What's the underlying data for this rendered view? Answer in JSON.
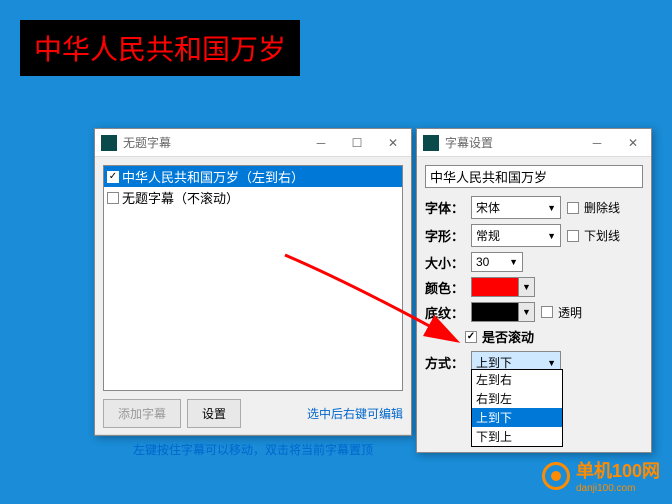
{
  "banner": "中华人民共和国万岁",
  "window1": {
    "title": "无题字幕",
    "list": [
      {
        "checked": true,
        "text": "中华人民共和国万岁（左到右）",
        "selected": true
      },
      {
        "checked": false,
        "text": "无题字幕（不滚动）",
        "selected": false
      }
    ],
    "btn_add": "添加字幕",
    "btn_settings": "设置",
    "hint_right": "选中后右键可编辑",
    "footer": "左键按住字幕可以移动，双击将当前字幕置顶"
  },
  "window2": {
    "title": "字幕设置",
    "input_value": "中华人民共和国万岁",
    "fields": {
      "font_label": "字体：",
      "font_value": "宋体",
      "strike_label": "删除线",
      "style_label": "字形：",
      "style_value": "常规",
      "underline_label": "下划线",
      "size_label": "大小：",
      "size_value": "30",
      "color_label": "颜色：",
      "color_value": "#ff0000",
      "bg_label": "底纹：",
      "bg_value": "#000000",
      "transparent_label": "透明",
      "scroll_label": "是否滚动",
      "scroll_checked": true,
      "mode_label": "方式：",
      "mode_value": "上到下"
    },
    "dropdown": {
      "items": [
        "左到右",
        "右到左",
        "上到下",
        "下到上"
      ],
      "highlighted": 2
    }
  },
  "watermark": {
    "name": "单机100网",
    "url": "danji100.com"
  }
}
